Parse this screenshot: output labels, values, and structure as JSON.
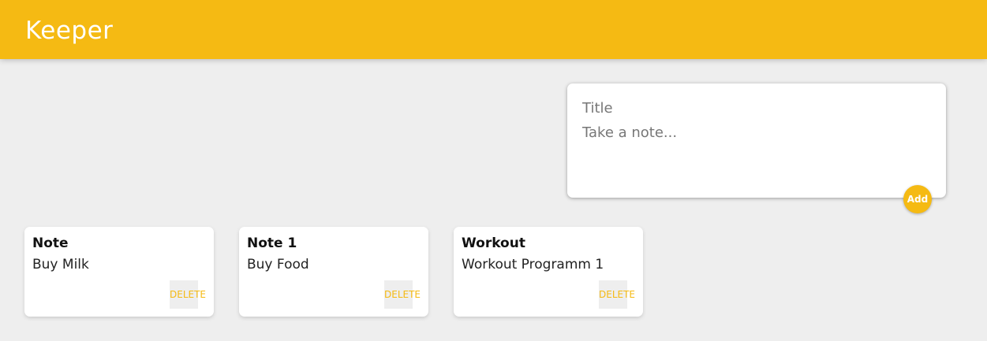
{
  "header": {
    "title": "Keeper"
  },
  "create_note": {
    "title_placeholder": "Title",
    "content_placeholder": "Take a note...",
    "add_label": "Add"
  },
  "notes": [
    {
      "title": "Note",
      "content": "Buy Milk",
      "delete_label": "DELETE"
    },
    {
      "title": "Note 1",
      "content": "Buy Food",
      "delete_label": "DELETE"
    },
    {
      "title": "Workout",
      "content": "Workout Programm 1",
      "delete_label": "DELETE"
    }
  ],
  "colors": {
    "accent": "#f5ba13",
    "background": "#eeeeee",
    "card": "#ffffff"
  }
}
